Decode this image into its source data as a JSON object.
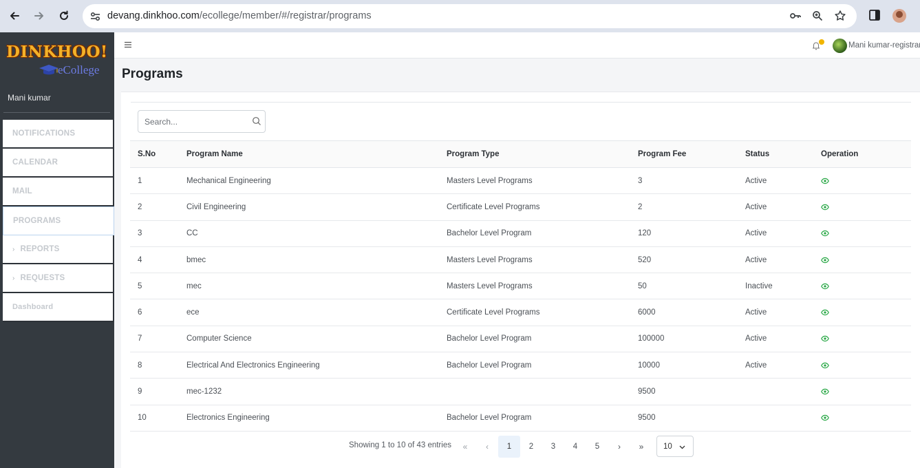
{
  "browser": {
    "url_host": "devang.dinkhoo.com",
    "url_path": "/ecollege/member/#/registrar/programs"
  },
  "brand": {
    "logo_text": "DINKHOO!",
    "logo_sub": "eCollege"
  },
  "sidebar": {
    "user_name": "Mani kumar",
    "items": [
      {
        "label": "NOTIFICATIONS",
        "chevron": false
      },
      {
        "label": "CALENDAR",
        "chevron": false
      },
      {
        "label": "MAIL",
        "chevron": false
      },
      {
        "label": "PROGRAMS",
        "chevron": false,
        "active": true
      },
      {
        "label": "REPORTS",
        "chevron": true
      },
      {
        "label": "REQUESTS",
        "chevron": true
      },
      {
        "label": "Dashboard",
        "chevron": false
      }
    ]
  },
  "header": {
    "user_label": "Mani kumar-registrar"
  },
  "page": {
    "title": "Programs"
  },
  "search": {
    "placeholder": "Search...",
    "value": ""
  },
  "table": {
    "columns": [
      "S.No",
      "Program Name",
      "Program Type",
      "Program Fee",
      "Status",
      "Operation"
    ],
    "rows": [
      {
        "sno": "1",
        "name": "Mechanical Engineering",
        "type": "Masters Level Programs",
        "fee": "3",
        "status": "Active"
      },
      {
        "sno": "2",
        "name": "Civil Engineering",
        "type": "Certificate Level Programs",
        "fee": "2",
        "status": "Active"
      },
      {
        "sno": "3",
        "name": "CC",
        "type": "Bachelor Level Program",
        "fee": "120",
        "status": "Active"
      },
      {
        "sno": "4",
        "name": "bmec",
        "type": "Masters Level Programs",
        "fee": "520",
        "status": "Active"
      },
      {
        "sno": "5",
        "name": "mec",
        "type": "Masters Level Programs",
        "fee": "50",
        "status": "Inactive"
      },
      {
        "sno": "6",
        "name": "ece",
        "type": "Certificate Level Programs",
        "fee": "6000",
        "status": "Active"
      },
      {
        "sno": "7",
        "name": "Computer Science",
        "type": "Bachelor Level Program",
        "fee": "100000",
        "status": "Active"
      },
      {
        "sno": "8",
        "name": "Electrical And Electronics Engineering",
        "type": "Bachelor Level Program",
        "fee": "10000",
        "status": "Active"
      },
      {
        "sno": "9",
        "name": "mec-1232",
        "type": "",
        "fee": "9500",
        "status": ""
      },
      {
        "sno": "10",
        "name": "Electronics Engineering",
        "type": "Bachelor Level Program",
        "fee": "9500",
        "status": ""
      }
    ]
  },
  "pagination": {
    "info": "Showing 1 to 10 of 43 entries",
    "first": "«",
    "prev": "‹",
    "pages": [
      "1",
      "2",
      "3",
      "4",
      "5"
    ],
    "current_page": "1",
    "next": "›",
    "last": "»",
    "page_size": "10"
  },
  "colors": {
    "sidebar_bg": "#343a40",
    "eye_icon": "#28a745",
    "bell_dot": "#f1b500",
    "active_border": "#b9d3ee"
  },
  "icons": {
    "operation": "eye-icon",
    "search": "search-icon",
    "menu": "hamburger-icon",
    "notifications": "bell-icon"
  }
}
